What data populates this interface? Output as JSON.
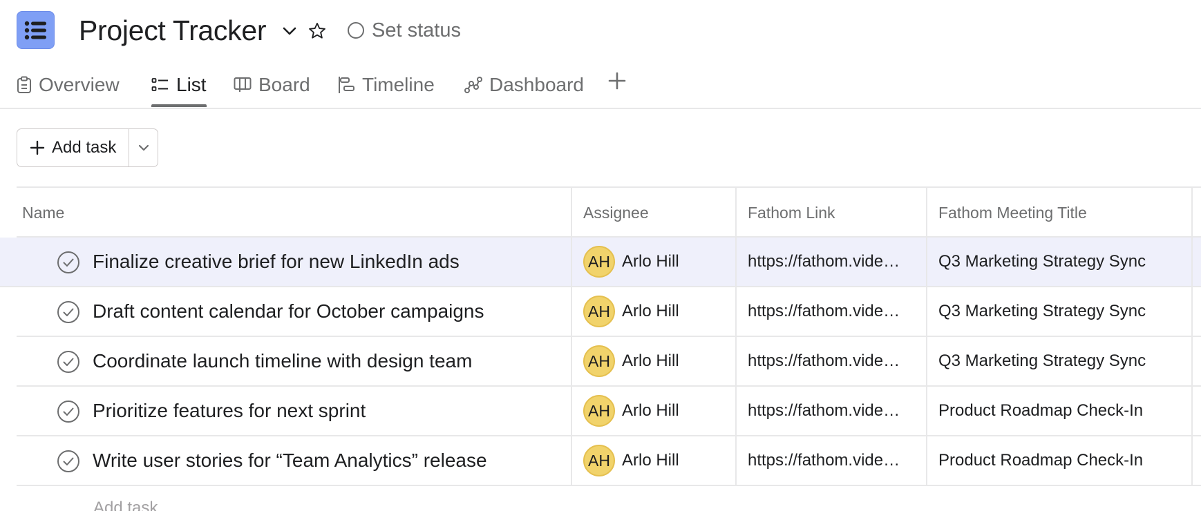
{
  "project": {
    "title": "Project Tracker",
    "set_status": "Set status",
    "icon": "list-icon",
    "accent": "#7f9ff5"
  },
  "tabs": [
    {
      "label": "Overview",
      "icon": "clipboard-icon",
      "active": false
    },
    {
      "label": "List",
      "icon": "list-icon",
      "active": true
    },
    {
      "label": "Board",
      "icon": "board-icon",
      "active": false
    },
    {
      "label": "Timeline",
      "icon": "timeline-icon",
      "active": false
    },
    {
      "label": "Dashboard",
      "icon": "dashboard-icon",
      "active": false
    }
  ],
  "toolbar": {
    "add_task_label": "Add task"
  },
  "table": {
    "columns": [
      "Name",
      "Assignee",
      "Fathom Link",
      "Fathom Meeting Title"
    ],
    "rows": [
      {
        "name": "Finalize creative brief for new LinkedIn ads",
        "assignee_initials": "AH",
        "assignee": "Arlo Hill",
        "link": "https://fathom.vide…",
        "meeting": "Q3 Marketing Strategy Sync"
      },
      {
        "name": "Draft content calendar for October campaigns",
        "assignee_initials": "AH",
        "assignee": "Arlo Hill",
        "link": "https://fathom.vide…",
        "meeting": "Q3 Marketing Strategy Sync"
      },
      {
        "name": "Coordinate launch timeline with design team",
        "assignee_initials": "AH",
        "assignee": "Arlo Hill",
        "link": "https://fathom.vide…",
        "meeting": "Q3 Marketing Strategy Sync"
      },
      {
        "name": "Prioritize features for next sprint",
        "assignee_initials": "AH",
        "assignee": "Arlo Hill",
        "link": "https://fathom.vide…",
        "meeting": "Product Roadmap Check-In"
      },
      {
        "name": "Write user stories for “Team Analytics” release",
        "assignee_initials": "AH",
        "assignee": "Arlo Hill",
        "link": "https://fathom.vide…",
        "meeting": "Product Roadmap Check-In"
      }
    ],
    "add_task_label": "Add task"
  }
}
